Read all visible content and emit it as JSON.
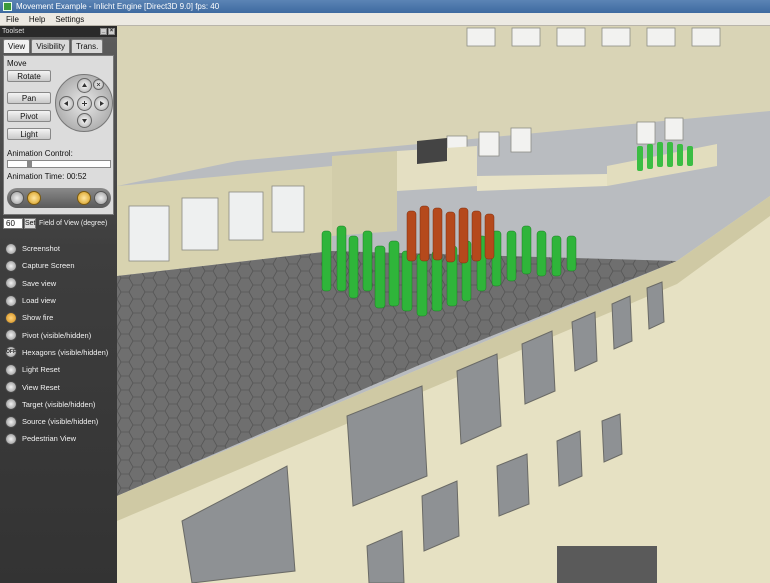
{
  "window": {
    "title": "Movement Example - Inlicht Engine [Direct3D 9.0] fps: 40"
  },
  "menu": [
    "File",
    "Help",
    "Settings"
  ],
  "toolset": {
    "title": "Toolset",
    "tabs": [
      "View",
      "Visibility",
      "Trans."
    ],
    "active_tab": "View",
    "move_label": "Move",
    "move_buttons": [
      "Rotate",
      "Pan",
      "Pivot",
      "Light"
    ],
    "animation_control_label": "Animation Control:",
    "animation_progress": 0.2,
    "animation_time_label": "Animation Time:",
    "animation_time": "00:52",
    "fov": {
      "value": "60",
      "set_label": "Set",
      "label": "Field of View (degree)"
    },
    "actions": [
      {
        "label": "Screenshot",
        "icon": "camera-icon"
      },
      {
        "label": "Capture Screen",
        "icon": "capture-icon"
      },
      {
        "label": "Save view",
        "icon": "save-view-icon"
      },
      {
        "label": "Load view",
        "icon": "load-view-icon"
      },
      {
        "label": "Show fire",
        "icon": "fire-icon"
      },
      {
        "label": "Pivot (visible/hidden)",
        "icon": "pivot-icon"
      },
      {
        "label": "Hexagons (visible/hidden)",
        "icon": "hexagon-toggle-icon",
        "badge": "OFF"
      },
      {
        "label": "Light Reset",
        "icon": "light-reset-icon"
      },
      {
        "label": "View Reset",
        "icon": "view-reset-icon"
      },
      {
        "label": "Target (visible/hidden)",
        "icon": "target-icon"
      },
      {
        "label": "Source (visible/hidden)",
        "icon": "source-icon"
      },
      {
        "label": "Pedestrian View",
        "icon": "pedestrian-icon"
      }
    ]
  },
  "colors": {
    "titlebar": "#4a75aa",
    "panel": "#444444",
    "facade": "#e6e1c2",
    "floor": "#6e6e6e",
    "agent_green": "#33b83a",
    "agent_red": "#b84a1c"
  }
}
